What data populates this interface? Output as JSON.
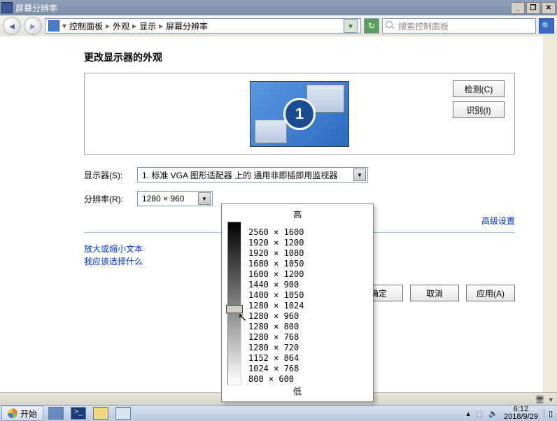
{
  "window": {
    "title": "屏幕分辨率"
  },
  "nav": {
    "breadcrumb": [
      "控制面板",
      "外观",
      "显示",
      "屏幕分辨率"
    ],
    "search_placeholder": "搜索控制面板"
  },
  "page": {
    "heading": "更改显示器的外观",
    "monitor_number": "1",
    "detect_btn": "检测(C)",
    "identify_btn": "识别(I)",
    "display_label": "显示器(S):",
    "display_value": "1. 标准 VGA 图形适配器 上的 通用非即插即用监视器",
    "resolution_label": "分辨率(R):",
    "resolution_value": "1280 × 960",
    "advanced_link": "高级设置",
    "link1": "放大或缩小文本",
    "link2": "我应该选择什么",
    "ok_btn": "确定",
    "cancel_btn": "取消",
    "apply_btn": "应用(A)"
  },
  "res_panel": {
    "high": "高",
    "low": "低",
    "options": [
      "2560 × 1600",
      "1920 × 1200",
      "1920 × 1080",
      "1680 × 1050",
      "1600 × 1200",
      "1440 × 900",
      "1400 × 1050",
      "1280 × 1024",
      "1280 × 960",
      "1280 × 800",
      "1280 × 768",
      "1280 × 720",
      "1152 × 864",
      "1024 × 768",
      "800 × 600"
    ]
  },
  "tray": {
    "time": "6:12",
    "date": "2018/9/29"
  },
  "start_label": "开始"
}
